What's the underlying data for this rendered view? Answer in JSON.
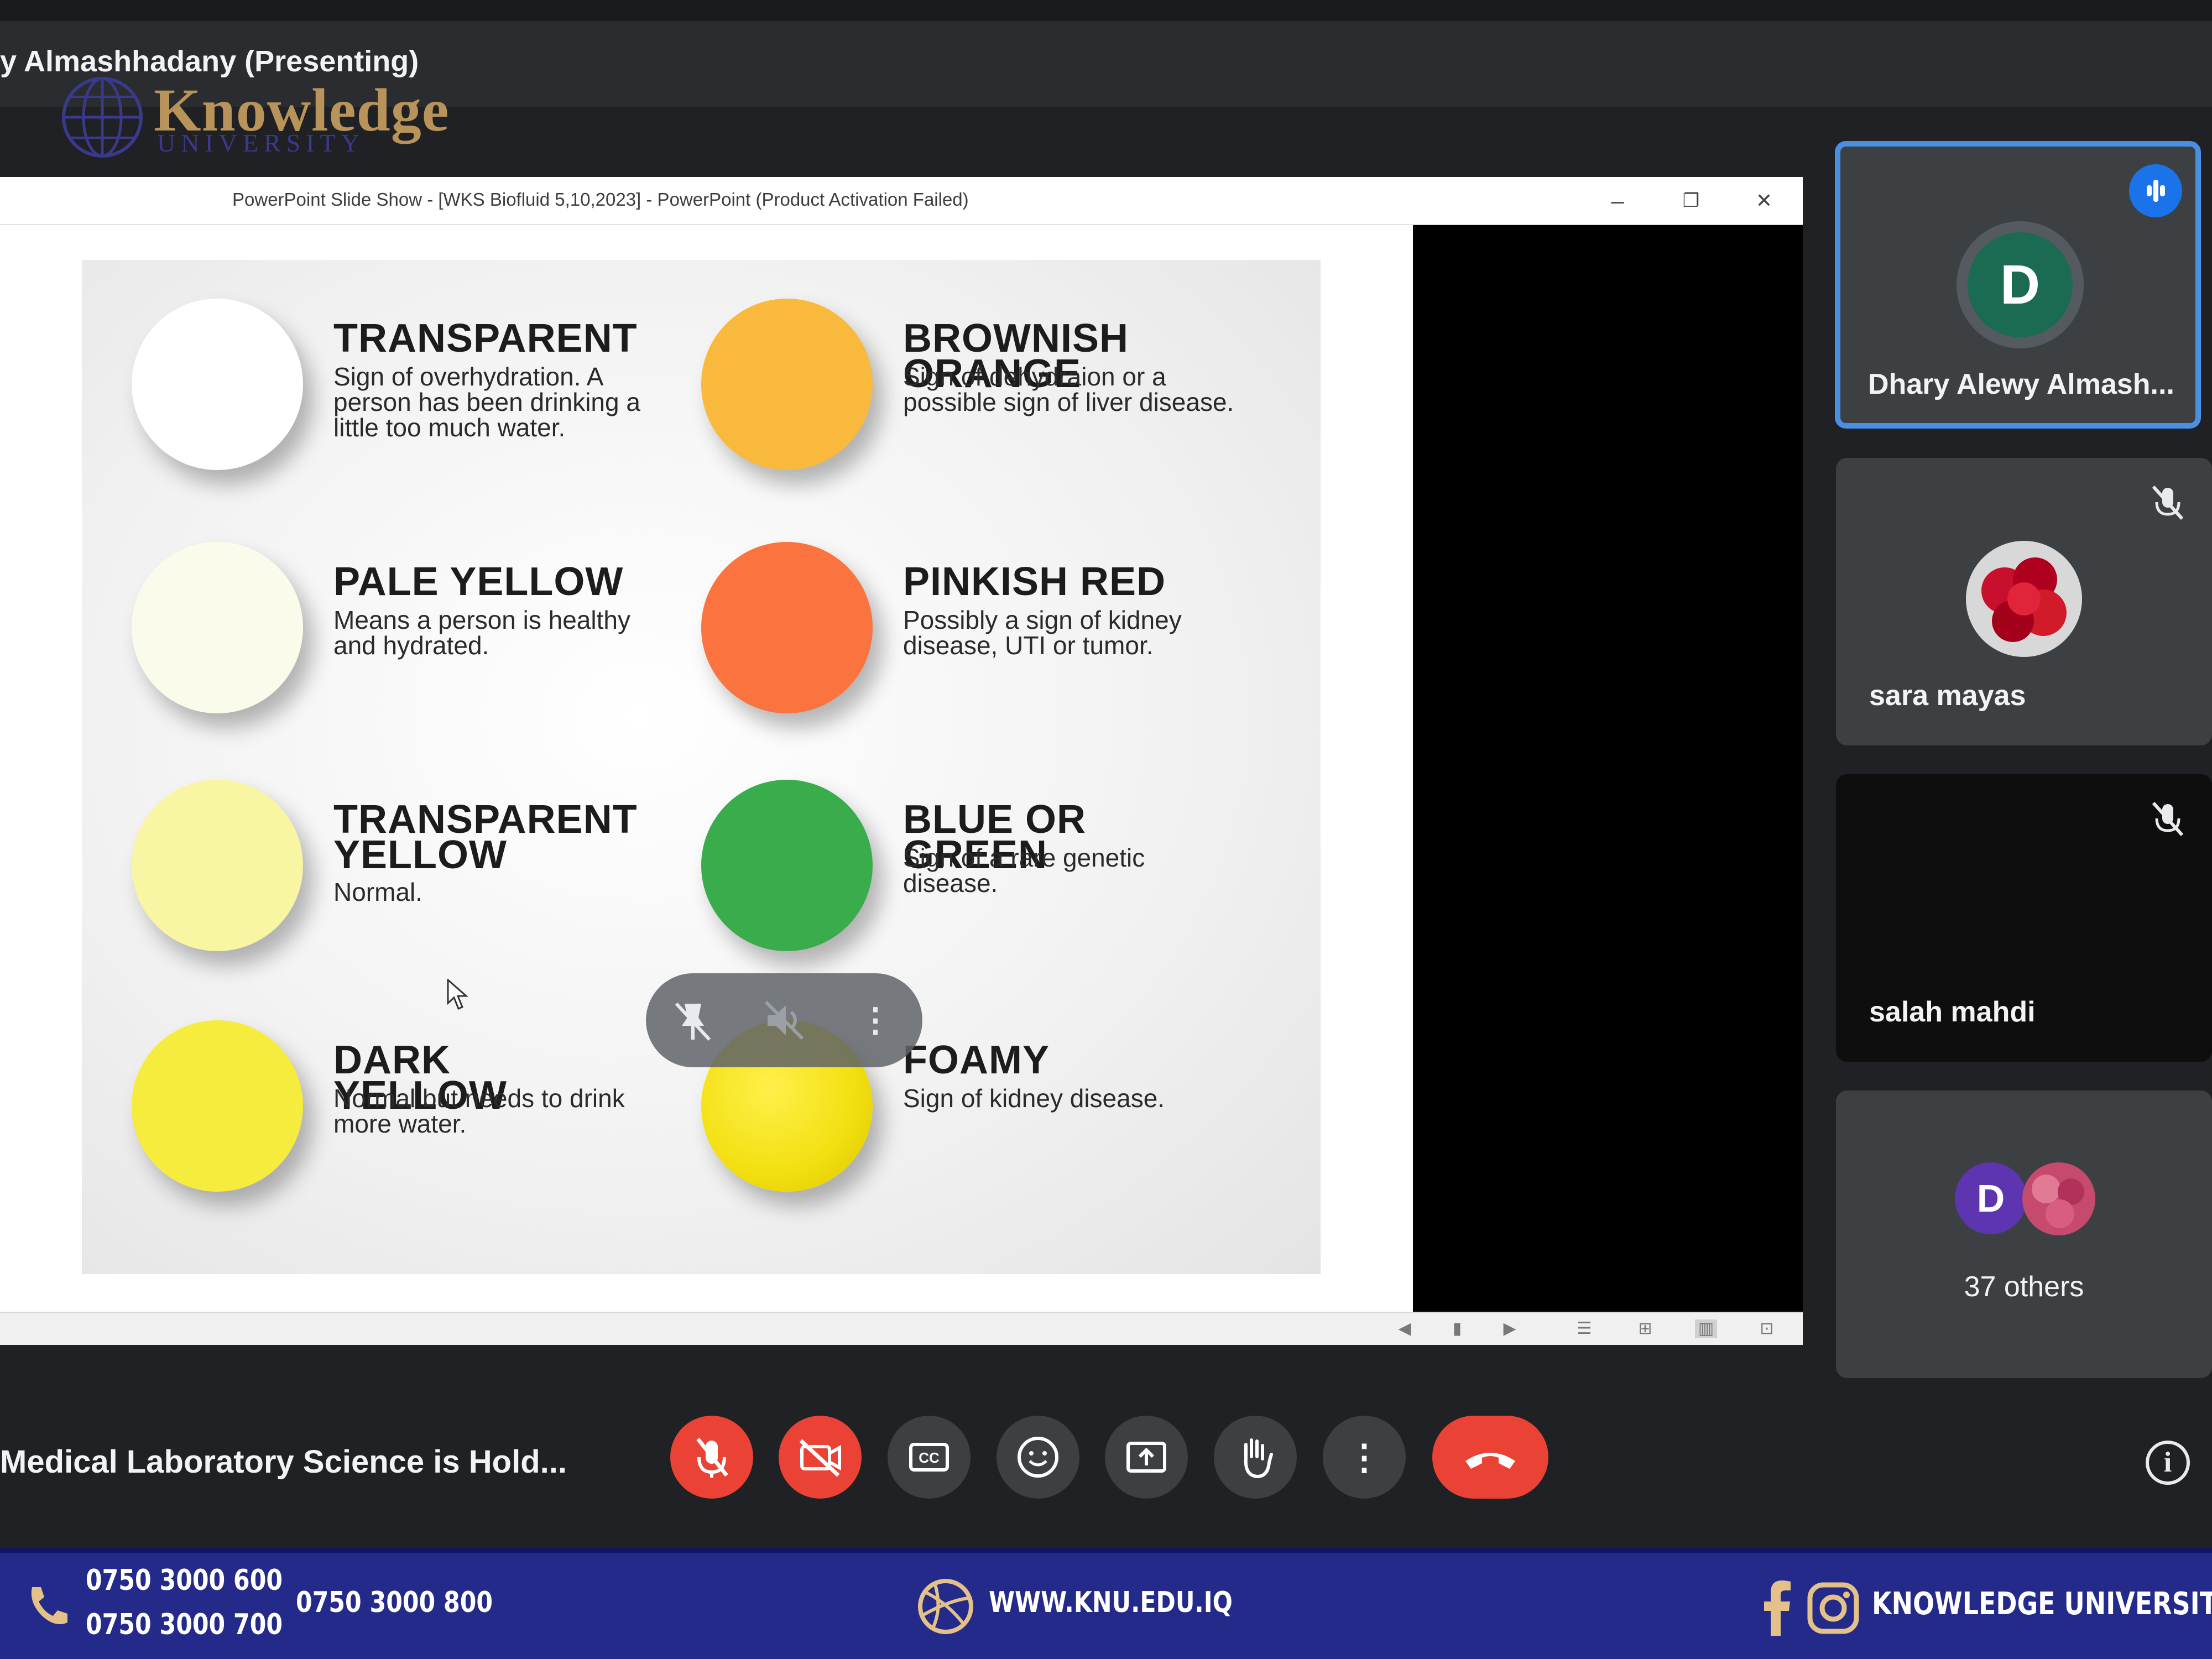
{
  "meet": {
    "presenter_label": "y Almashhadany (Presenting)",
    "meeting_title": "Medical Laboratory Science is Hold..."
  },
  "branding": {
    "logo_word": "Knowledge",
    "logo_sub": "UNIVERSITY",
    "brand_color": "#b8935a"
  },
  "ppt": {
    "window_title": "PowerPoint Slide Show - [WKS  Biofluid 5,10,2023] - PowerPoint (Product Activation Failed)",
    "minimize": "–",
    "restore": "❐",
    "close": "✕"
  },
  "slide": {
    "items": [
      {
        "title": "TRANSPARENT",
        "desc": "Sign of overhydration. A person has been drinking a little too much water.",
        "color": "#ffffff"
      },
      {
        "title": "BROWNISH ORANGE",
        "desc": "Sign of dehydraion or a possible sign of liver disease.",
        "color": "#f9b93c"
      },
      {
        "title": "PALE YELLOW",
        "desc": "Means a person is healthy and hydrated.",
        "color": "#fbfbeb"
      },
      {
        "title": "PINKISH RED",
        "desc": "Possibly a sign of kidney disease, UTI or tumor.",
        "color": "#fb7440"
      },
      {
        "title": "TRANSPARENT\nYELLOW",
        "desc": "Normal.",
        "color": "#f8f5a3"
      },
      {
        "title": "BLUE OR GREEN",
        "desc": "Sign of a rare genetic disease.",
        "color": "#39ad4b"
      },
      {
        "title": "DARK YELLOW",
        "desc": "Normal but needs to drink more water.",
        "color": "#f5ec3e"
      },
      {
        "title": "FOAMY",
        "desc": "Sign of kidney disease.",
        "color": "#f2df10"
      }
    ]
  },
  "participants": [
    {
      "name": "Dhary Alewy Almash...",
      "initial": "D",
      "avatar_color": "#1b6b53",
      "speaking": true
    },
    {
      "name": "sara mayas",
      "muted": true
    },
    {
      "name": "salah mahdi",
      "muted": true
    },
    {
      "name": "37 others",
      "initial": "D",
      "avatar_color": "#5e35b1"
    }
  ],
  "controls": [
    {
      "name": "mic-off",
      "state": "off"
    },
    {
      "name": "camera-off",
      "state": "off"
    },
    {
      "name": "captions"
    },
    {
      "name": "emoji"
    },
    {
      "name": "present"
    },
    {
      "name": "raise-hand"
    },
    {
      "name": "more-options"
    },
    {
      "name": "end-call"
    }
  ],
  "footer": {
    "phone1": "0750 3000 600",
    "phone2": "0750 3000 700",
    "phone3": "0750 3000 800",
    "website": "WWW.KNU.EDU.IQ",
    "social": "KNOWLEDGE UNIVERSITY",
    "bg_color": "#232a8a"
  }
}
